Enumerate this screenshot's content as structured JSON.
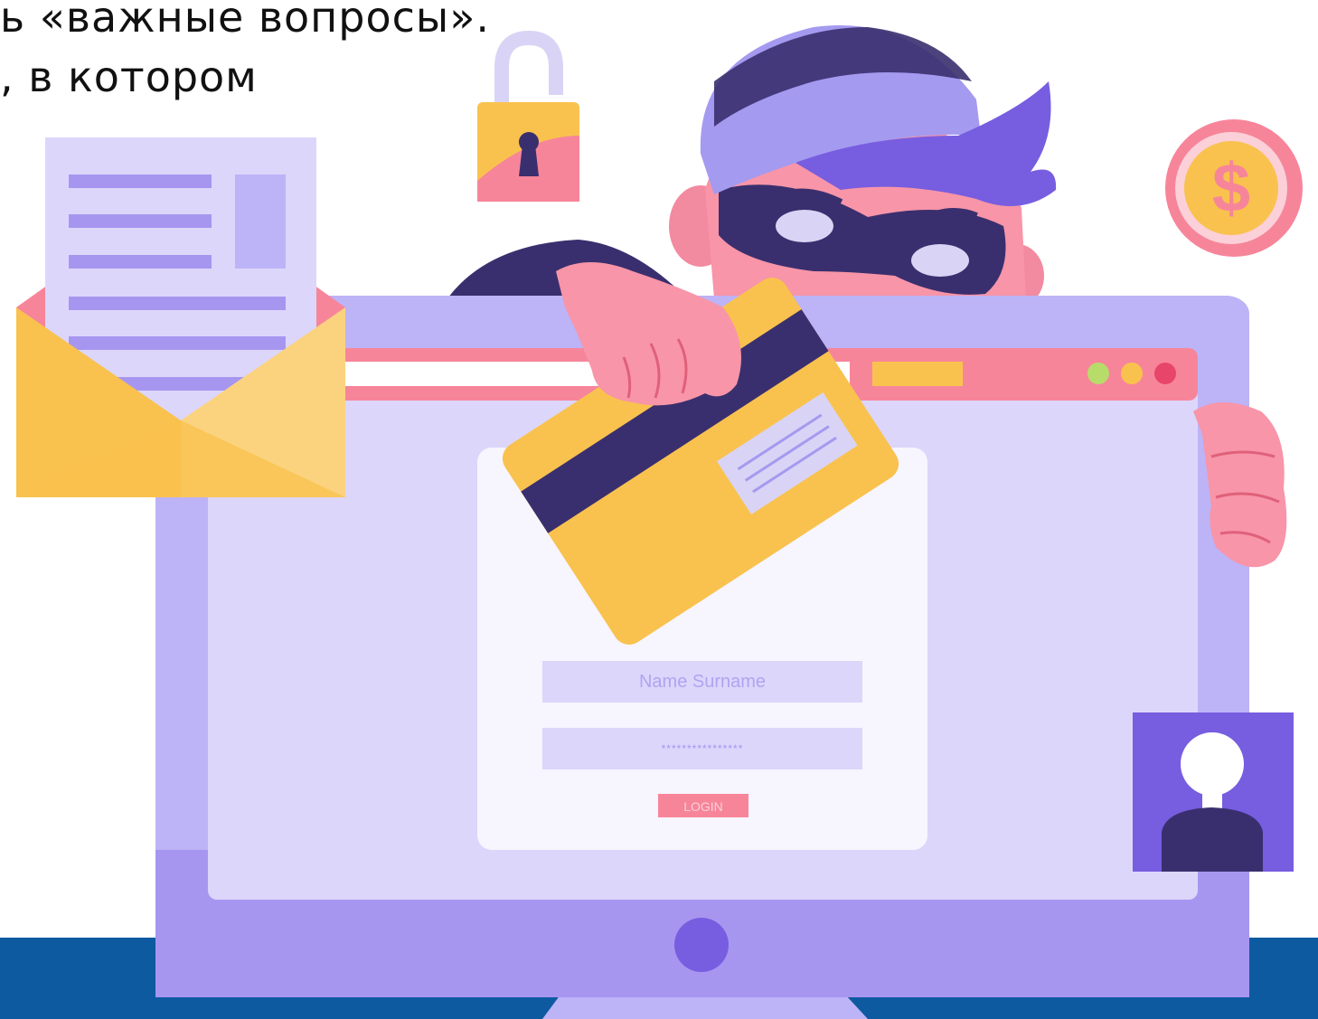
{
  "caption": {
    "line1": "ь «важные вопросы».",
    "line2": ", в котором"
  },
  "login_form": {
    "name_placeholder": "Name Surname",
    "password_mask": "****************",
    "login_label": "LOGIN"
  },
  "coin_symbol": "$",
  "colors": {
    "monitor_frame": "#bdb3f7",
    "monitor_bottom": "#a796f0",
    "screen": "#dcd6fb",
    "browser_bar": "#f7859a",
    "card": "#f9c24e",
    "card_stripe": "#3a2f6e",
    "envelope": "#f9c24e",
    "skin": "#f895a8",
    "hat": "#a49af0",
    "hair": "#775de0",
    "mask": "#3a2f6e",
    "floor": "#0e5aa0",
    "avatar_bg": "#7a62db",
    "login_button": "#f7859a"
  },
  "icons": [
    "padlock-icon",
    "dollar-coin-icon",
    "envelope-icon",
    "user-avatar-icon",
    "credit-card-icon",
    "browser-dots-icon"
  ]
}
